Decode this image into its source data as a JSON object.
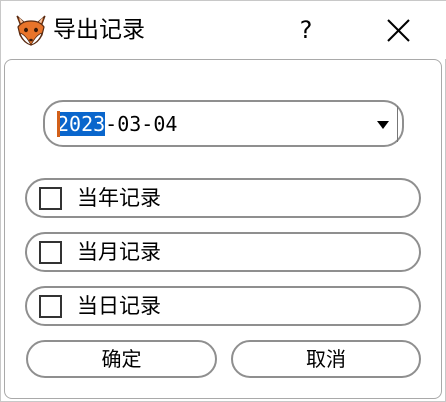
{
  "window": {
    "title": "导出记录",
    "help_label": "?",
    "app_icon": "fox-icon",
    "close_icon": "close-icon"
  },
  "date_picker": {
    "year": "2023",
    "rest": "-03-04",
    "dropdown_icon": "triangle-down-icon"
  },
  "options": [
    {
      "label": "当年记录",
      "checked": false
    },
    {
      "label": "当月记录",
      "checked": false
    },
    {
      "label": "当日记录",
      "checked": false
    }
  ],
  "buttons": {
    "ok_label": "确定",
    "cancel_label": "取消"
  },
  "colors": {
    "selection": "#0a66cc",
    "caret": "#d2601a",
    "border": "#8f8f8f",
    "fox_orange": "#e8742a"
  }
}
